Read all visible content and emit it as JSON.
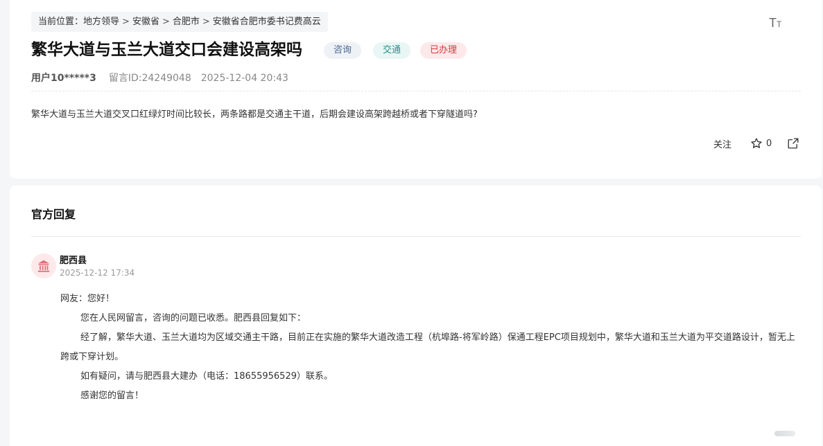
{
  "breadcrumb": {
    "prefix": "当前位置：",
    "items": [
      "地方领导",
      "安徽省",
      "合肥市",
      "安徽省合肥市委书记费高云"
    ],
    "separator": ">"
  },
  "font_size_icon": "font-size-icon",
  "post": {
    "title": "繁华大道与玉兰大道交口会建设高架吗",
    "tags": [
      "咨询",
      "交通",
      "已办理"
    ],
    "user": "用户10*****3",
    "message_id": "留言ID:24249048",
    "datetime": "2025-12-04 20:43",
    "content": "繁华大道与玉兰大道交叉口红绿灯时间比较长，两条路都是交通主干道，后期会建设高架跨越桥或者下穿隧道吗?",
    "follow_label": "关注",
    "favorite_count": "0"
  },
  "reply": {
    "section_title": "官方回复",
    "org_name": "肥西县",
    "datetime": "2025-12-12 17:34",
    "greeting": "网友：您好！",
    "paragraphs": [
      "您在人民网留言，咨询的问题已收悉。肥西县回复如下：",
      "经了解，繁华大道、玉兰大道均为区域交通主干路，目前正在实施的繁华大道改造工程（杭埠路-将军岭路）保通工程EPC项目规划中，繁华大道和玉兰大道为平交道路设计，暂无上跨或下穿计划。",
      "如有疑问，请与肥西县大建办（电话：18655956529）联系。",
      "感谢您的留言！"
    ]
  },
  "colors": {
    "tag_consult": "#4a6891",
    "tag_traffic": "#2a8f8a",
    "tag_done": "#d9363e",
    "avatar_bg": "#fde9ea",
    "avatar_icon": "#e0707a"
  }
}
